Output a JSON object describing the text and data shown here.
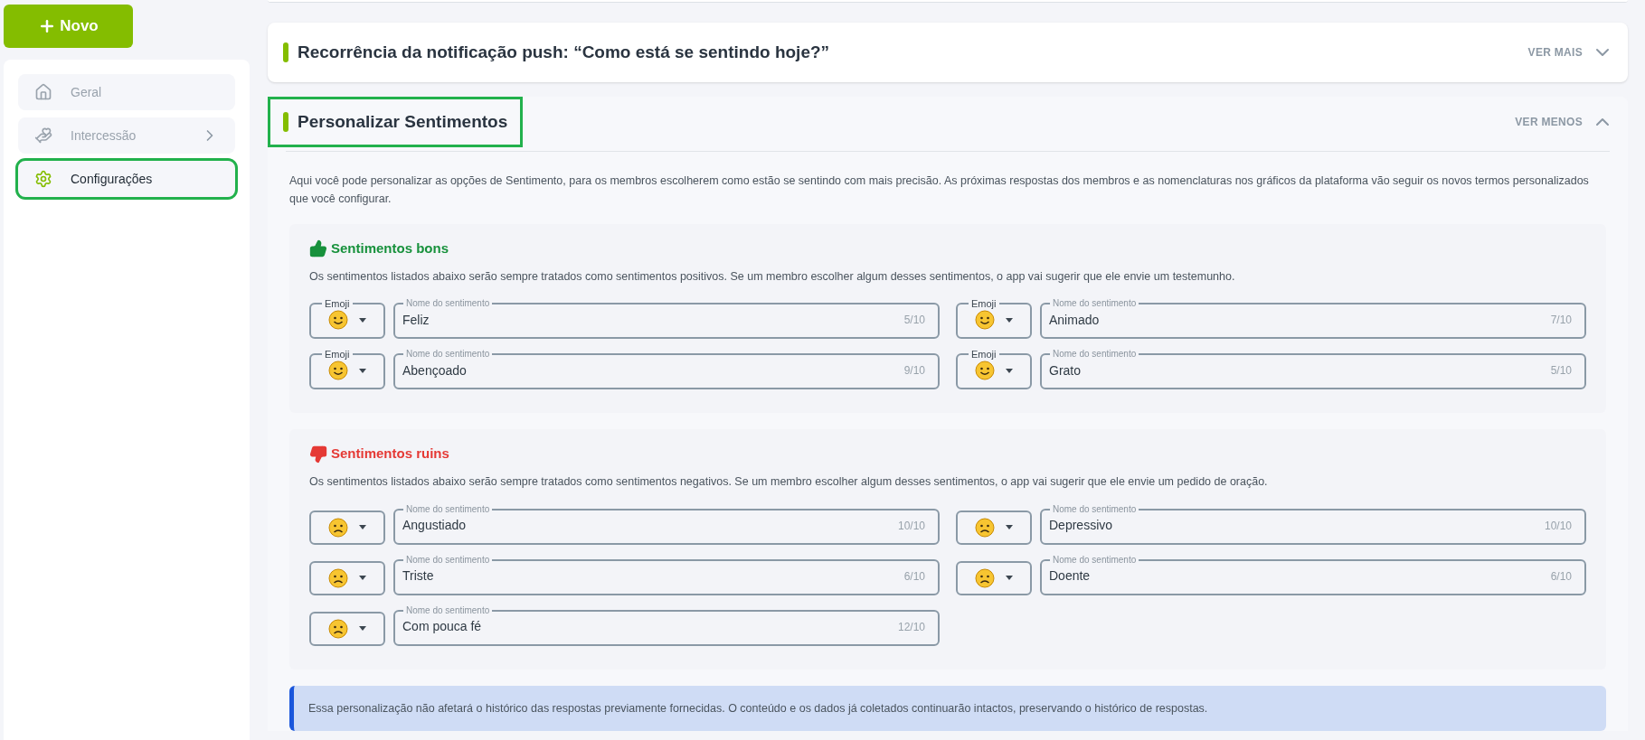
{
  "new_button": {
    "label": "Novo"
  },
  "sidebar": {
    "items": [
      {
        "kind": "home",
        "label": "Geral",
        "selected": false,
        "has_children": false
      },
      {
        "kind": "hands",
        "label": "Intercessão",
        "selected": false,
        "has_children": true
      },
      {
        "kind": "gear",
        "label": "Configurações",
        "selected": true,
        "has_children": false
      }
    ]
  },
  "panels": [
    {
      "title": "Recorrência da notificação push: “Como está se sentindo hoje?”",
      "toggle": "VER MAIS",
      "expanded": false,
      "highlighted": false
    },
    {
      "title": "Personalizar Sentimentos",
      "toggle": "VER MENOS",
      "expanded": true,
      "highlighted": true
    }
  ],
  "description": "Aqui você pode personalizar as opções de Sentimento, para os membros escolherem como estão se sentindo com mais precisão. As próximas respostas dos membros e as nomenclaturas nos gráficos da plataforma vão seguir os novos termos personalizados que você configurar.",
  "groups": [
    {
      "kind": "good",
      "title": "Sentimentos bons",
      "text": "Os sentimentos listados abaixo serão sempre tratados como sentimentos positivos. Se um membro escolher algum desses sentimentos, o app vai sugerir que ele envie um testemunho.",
      "feelings": [
        {
          "emoji_label": "Emoji",
          "field_label": "Nome do sentimento",
          "value": "Feliz",
          "count": "5/10"
        },
        {
          "emoji_label": "Emoji",
          "field_label": "Nome do sentimento",
          "value": "Animado",
          "count": "7/10"
        },
        {
          "emoji_label": "Emoji",
          "field_label": "Nome do sentimento",
          "value": "Abençoado",
          "count": "9/10"
        },
        {
          "emoji_label": "Emoji",
          "field_label": "Nome do sentimento",
          "value": "Grato",
          "count": "5/10"
        }
      ]
    },
    {
      "kind": "bad",
      "title": "Sentimentos ruins",
      "text": "Os sentimentos listados abaixo serão sempre tratados como sentimentos negativos. Se um membro escolher algum desses sentimentos, o app vai sugerir que ele envie um pedido de oração.",
      "feelings": [
        {
          "field_label": "Nome do sentimento",
          "value": "Angustiado",
          "count": "10/10"
        },
        {
          "field_label": "Nome do sentimento",
          "value": "Depressivo",
          "count": "10/10"
        },
        {
          "field_label": "Nome do sentimento",
          "value": "Triste",
          "count": "6/10"
        },
        {
          "field_label": "Nome do sentimento",
          "value": "Doente",
          "count": "6/10"
        },
        {
          "field_label": "Nome do sentimento",
          "value": "Com pouca fé",
          "count": "12/10"
        }
      ]
    }
  ],
  "notice": "Essa personalização não afetará o histórico das respostas previamente fornecidas. O conteúdo e os dados já coletados continuarão intactos, preservando o histórico de respostas."
}
